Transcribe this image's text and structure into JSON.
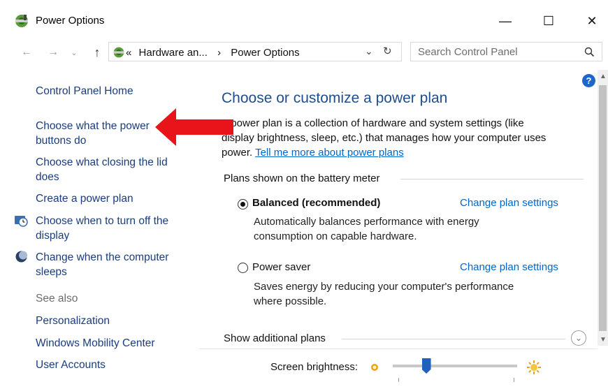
{
  "window": {
    "title": "Power Options"
  },
  "title_buttons": {
    "minimize": "—",
    "maximize": "☐",
    "close": "✕"
  },
  "nav": {
    "address_prefix": "«",
    "breadcrumb_1": "Hardware an...",
    "breadcrumb_sep": "›",
    "breadcrumb_2": "Power Options",
    "search_placeholder": "Search Control Panel"
  },
  "sidebar": {
    "home": "Control Panel Home",
    "items": [
      {
        "line1": "Choose what the power",
        "line2": "buttons do"
      },
      {
        "line1": "Choose what closing the lid",
        "line2": "does"
      },
      {
        "line1": "Create a power plan",
        "line2": ""
      },
      {
        "line1": "Choose when to turn off the",
        "line2": "display"
      },
      {
        "line1": "Change when the computer",
        "line2": "sleeps"
      }
    ],
    "see_also": "See also",
    "see_also_links": [
      "Personalization",
      "Windows Mobility Center",
      "User Accounts"
    ]
  },
  "main": {
    "title": "Choose or customize a power plan",
    "desc_line1": "A power plan is a collection of hardware and system settings (like",
    "desc_line2": "display brightness, sleep, etc.) that manages how your computer uses",
    "desc_line3_prefix": "power. ",
    "desc_link": "Tell me more about power plans",
    "plans_section": "Plans shown on the battery meter",
    "plans": [
      {
        "name": "Balanced (recommended)",
        "selected": true,
        "change": "Change plan settings",
        "desc": "Automatically balances performance with energy consumption on capable hardware."
      },
      {
        "name": "Power saver",
        "selected": false,
        "change": "Change plan settings",
        "desc": "Saves energy by reducing your computer's performance where possible."
      }
    ],
    "show_additional": "Show additional plans",
    "brightness_label": "Screen brightness:",
    "brightness_level": 0.27
  },
  "annotation": {
    "arrow_color": "#e8141a"
  }
}
